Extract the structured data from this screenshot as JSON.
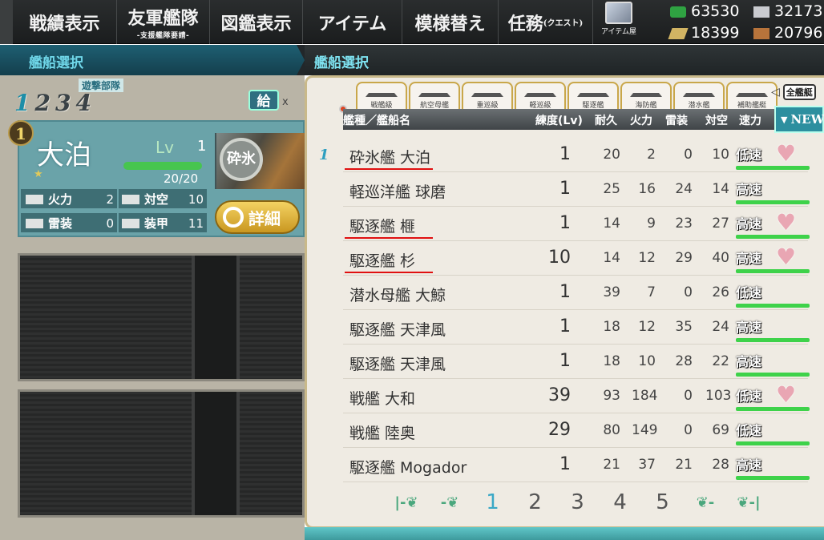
{
  "menu": {
    "items": [
      {
        "label": "戦績表示",
        "sub": ""
      },
      {
        "label": "友軍艦隊",
        "sub": "-支援艦隊要請-"
      },
      {
        "label": "図鑑表示",
        "sub": ""
      },
      {
        "label": "アイテム",
        "sub": ""
      },
      {
        "label": "模様替え",
        "sub": ""
      },
      {
        "label": "任務",
        "sub": "(クエスト)"
      }
    ],
    "shop_label": "アイテム屋"
  },
  "resources": {
    "fuel": "63530",
    "steel": "32173",
    "ammo": "18399",
    "bauxite": "20796"
  },
  "left": {
    "header": "艦船選択",
    "fleet_name": "遊撃部隊",
    "fleet_tabs": [
      "1",
      "2",
      "3",
      "4"
    ],
    "supply_label": "給",
    "supply_x": "x",
    "slot_number": "1",
    "ship": {
      "name": "大泊",
      "lv_label": "Lv",
      "lv": "1",
      "hp_text": "20/20",
      "hp_fraction": 1.0,
      "portrait_seal": "砕氷",
      "stats": [
        {
          "label": "火力",
          "value": "2"
        },
        {
          "label": "対空",
          "value": "10"
        },
        {
          "label": "雷装",
          "value": "0"
        },
        {
          "label": "装甲",
          "value": "11"
        }
      ]
    },
    "detail_label": "詳細"
  },
  "right": {
    "header": "艦船選択",
    "category_tabs": [
      "戦艦級",
      "航空母艦",
      "重巡級",
      "軽巡級",
      "駆逐艦",
      "海防艦",
      "潜水艦",
      "補助艦艇"
    ],
    "all_tab": "全艦艇",
    "sort_button": "NEW",
    "columns": [
      "艦種／艦船名",
      "練度(Lv)",
      "耐久",
      "火力",
      "雷装",
      "対空",
      "速力"
    ],
    "fleet_mark": "1",
    "rows": [
      {
        "type_name": "砕氷艦 大泊",
        "lv": "1",
        "hp": "20",
        "fp": "2",
        "tp": "0",
        "aa": "10",
        "speed": "低速",
        "locked": true,
        "underline": true
      },
      {
        "type_name": "軽巡洋艦 球磨",
        "lv": "1",
        "hp": "25",
        "fp": "16",
        "tp": "24",
        "aa": "14",
        "speed": "高速",
        "locked": false,
        "underline": false
      },
      {
        "type_name": "駆逐艦 榧",
        "lv": "1",
        "hp": "14",
        "fp": "9",
        "tp": "23",
        "aa": "27",
        "speed": "高速",
        "locked": true,
        "underline": true
      },
      {
        "type_name": "駆逐艦 杉",
        "lv": "10",
        "hp": "14",
        "fp": "12",
        "tp": "29",
        "aa": "40",
        "speed": "高速",
        "locked": true,
        "underline": true
      },
      {
        "type_name": "潜水母艦 大鯨",
        "lv": "1",
        "hp": "39",
        "fp": "7",
        "tp": "0",
        "aa": "26",
        "speed": "低速",
        "locked": false,
        "underline": false
      },
      {
        "type_name": "駆逐艦 天津風",
        "lv": "1",
        "hp": "18",
        "fp": "12",
        "tp": "35",
        "aa": "24",
        "speed": "高速",
        "locked": false,
        "underline": false
      },
      {
        "type_name": "駆逐艦 天津風",
        "lv": "1",
        "hp": "18",
        "fp": "10",
        "tp": "28",
        "aa": "22",
        "speed": "高速",
        "locked": false,
        "underline": false
      },
      {
        "type_name": "戦艦 大和",
        "lv": "39",
        "hp": "93",
        "fp": "184",
        "tp": "0",
        "aa": "103",
        "speed": "低速",
        "locked": true,
        "underline": false
      },
      {
        "type_name": "戦艦 陸奥",
        "lv": "29",
        "hp": "80",
        "fp": "149",
        "tp": "0",
        "aa": "69",
        "speed": "低速",
        "locked": false,
        "underline": false
      },
      {
        "type_name": "駆逐艦 Mogador",
        "lv": "1",
        "hp": "21",
        "fp": "37",
        "tp": "21",
        "aa": "28",
        "speed": "高速",
        "locked": false,
        "underline": false
      }
    ],
    "pager": {
      "first": "|-❦",
      "prev": "-❦",
      "pages": [
        "1",
        "2",
        "3",
        "4",
        "5"
      ],
      "current": "1",
      "next": "❦-",
      "last": "❦-|"
    }
  }
}
